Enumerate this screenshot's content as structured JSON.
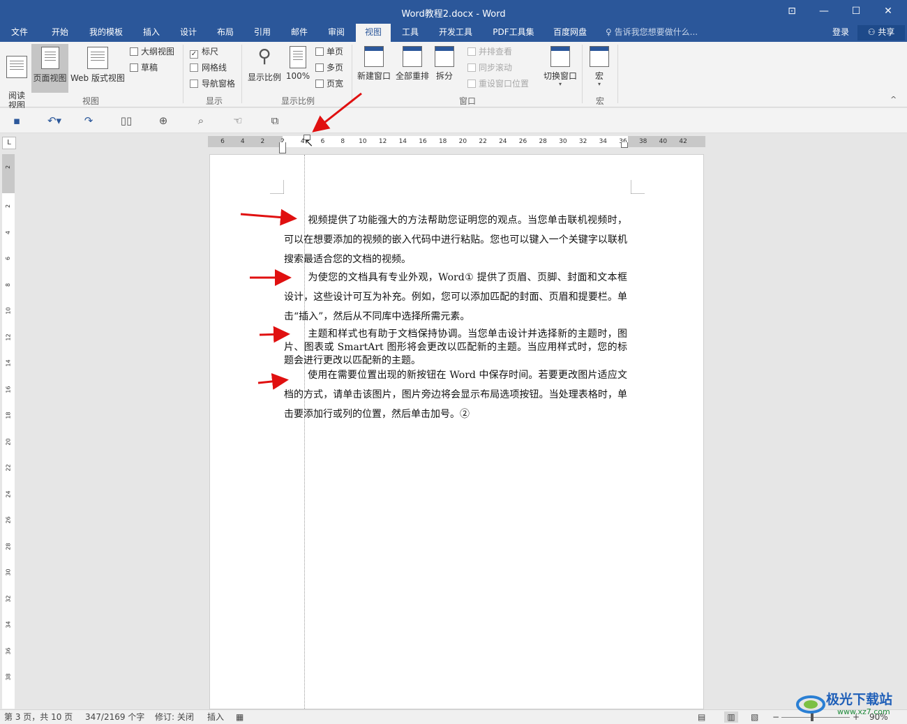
{
  "window": {
    "title": "Word教程2.docx - Word",
    "restore_icon": "⊡",
    "minimize_icon": "—",
    "maximize_icon": "☐",
    "close_icon": "✕"
  },
  "tabs": [
    "文件",
    "开始",
    "我的模板",
    "插入",
    "设计",
    "布局",
    "引用",
    "邮件",
    "审阅",
    "视图",
    "工具",
    "开发工具",
    "PDF工具集",
    "百度网盘"
  ],
  "active_tab": "视图",
  "tellme": "告诉我您想要做什么...",
  "login": "登录",
  "share": "共享",
  "ribbon": {
    "view_group": {
      "read_mode": "阅读\n视图",
      "print_layout": "页面视图",
      "web_layout": "Web 版式视图",
      "outline": "大纲视图",
      "draft": "草稿",
      "label": "视图"
    },
    "show_group": {
      "ruler": "标尺",
      "ruler_checked": true,
      "gridlines": "网格线",
      "nav_pane": "导航窗格",
      "label": "显示"
    },
    "zoom_group": {
      "zoom": "显示比例",
      "hundred": "100%",
      "one_page": "单页",
      "multi_page": "多页",
      "page_width": "页宽",
      "label": "显示比例"
    },
    "window_group": {
      "new_window": "新建窗口",
      "arrange_all": "全部重排",
      "split": "拆分",
      "side_by_side": "并排查看",
      "sync_scroll": "同步滚动",
      "reset_position": "重设窗口位置",
      "switch_windows": "切换窗口",
      "label": "窗口"
    },
    "macro_group": {
      "macros": "宏",
      "label": "宏"
    }
  },
  "ruler": {
    "h_ticks": [
      "6",
      "4",
      "2",
      "2",
      "4",
      "6",
      "8",
      "10",
      "12",
      "14",
      "16",
      "18",
      "20",
      "22",
      "24",
      "26",
      "28",
      "30",
      "32",
      "34",
      "36",
      "38",
      "40",
      "42"
    ],
    "v_ticks": [
      "2",
      "2",
      "4",
      "6",
      "8",
      "10",
      "12",
      "14",
      "16",
      "18",
      "20",
      "22",
      "24",
      "26",
      "28",
      "30",
      "32",
      "34",
      "36",
      "38"
    ],
    "corner": "L"
  },
  "document": {
    "paragraphs": [
      "视频提供了功能强大的方法帮助您证明您的观点。当您单击联机视频时，可以在想要添加的视频的嵌入代码中进行粘贴。您也可以键入一个关键字以联机搜索最适合您的文档的视频。",
      "为使您的文档具有专业外观，Word① 提供了页眉、页脚、封面和文本框设计，这些设计可互为补充。例如，您可以添加匹配的封面、页眉和提要栏。单击“插入”，然后从不同库中选择所需元素。",
      "主题和样式也有助于文档保持协调。当您单击设计并选择新的主题时，图片、图表或 SmartArt 图形将会更改以匹配新的主题。当应用样式时，您的标题会进行更改以匹配新的主题。",
      "使用在需要位置出现的新按钮在 Word 中保存时间。若要更改图片适应文档的方式，请单击该图片，图片旁边将会显示布局选项按钮。当处理表格时，单击要添加行或列的位置，然后单击加号。②"
    ]
  },
  "status": {
    "page": "第 3 页，共 10 页",
    "words": "347/2169 个字",
    "track": "修订: 关闭",
    "insert": "插入",
    "zoom_minus": "−",
    "zoom_plus": "+",
    "zoom": "90%"
  },
  "watermark": {
    "text": "极光下载站",
    "url": "www.xz7.com"
  },
  "colors": {
    "brand": "#2b579a",
    "arrow": "#e01010"
  }
}
